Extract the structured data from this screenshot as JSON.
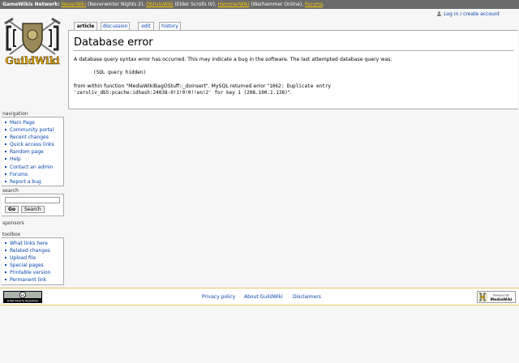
{
  "network_bar": {
    "label": "GameWikis Network:",
    "items": [
      {
        "name": "NeverWiki",
        "detail": "(Neverwinter Nights 2),"
      },
      {
        "name": "OblivioWiki",
        "detail": "(Elder Scrolls IV),"
      },
      {
        "name": "HammerWiki",
        "detail": "(Warhammer Online),"
      },
      {
        "name": "Forums",
        "detail": "."
      }
    ]
  },
  "logo": {
    "text": "GuildWiki"
  },
  "personal": {
    "login_label": "Log in / create account"
  },
  "tabs": [
    {
      "label": "article",
      "selected": true
    },
    {
      "label": "discussion",
      "selected": false
    },
    {
      "label": "edit",
      "selected": false
    },
    {
      "label": "history",
      "selected": false
    }
  ],
  "content": {
    "title": "Database error",
    "intro": "A database query syntax error has occurred. This may indicate a bug in the software. The last attempted database query was:",
    "query": "(SQL query hidden)",
    "fn_prefix": "from within function \"",
    "fn_name": "MediaWikiBagOStuff::_doinsert",
    "fn_mid": "\". MySQL returned error \"",
    "error_code": "1062: Duplicate entry",
    "error_detail": "'zeroliv_db5:pcache:idhash:24038-0!1!0!0!!en!2' for key 1 (208.100.1.138)",
    "error_suffix": "\"."
  },
  "sidebar": {
    "navigation": {
      "heading": "navigation",
      "items": [
        "Main Page",
        "Community portal",
        "Recent changes",
        "Quick access links",
        "Random page",
        "Help",
        "Contact an admin",
        "Forums",
        "Report a bug"
      ]
    },
    "search": {
      "heading": "search",
      "go_label": "Go",
      "search_label": "Search"
    },
    "sponsors": {
      "heading": "sponsors"
    },
    "toolbox": {
      "heading": "toolbox",
      "items": [
        "What links here",
        "Related changes",
        "Upload file",
        "Special pages",
        "Printable version",
        "Permanent link"
      ]
    }
  },
  "footer": {
    "links": [
      "Privacy policy",
      "About GuildWiki",
      "Disclaimers"
    ],
    "cc_badge_text": "SOME RIGHTS RESERVED",
    "mw_badge_text": [
      "Powered By",
      "MediaWiki"
    ]
  },
  "colors": {
    "network_bar_bg": "#6b6b6b",
    "network_link": "#ffcc00",
    "link": "#0645ad",
    "footer_border": "#e2c65b"
  }
}
